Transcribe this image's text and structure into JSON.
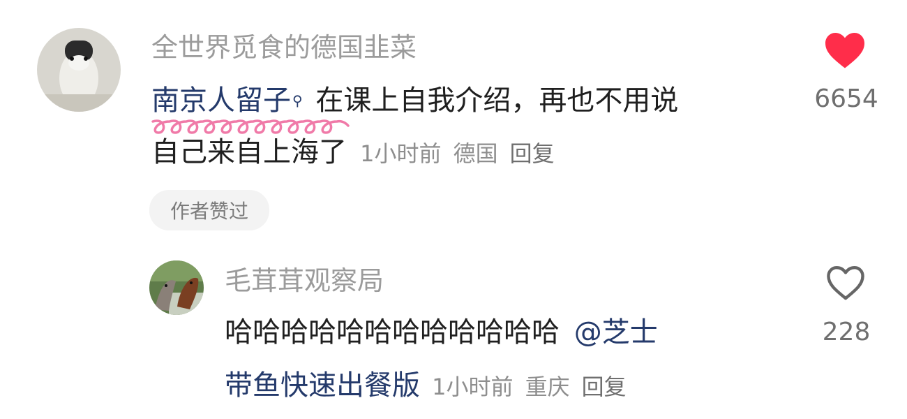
{
  "comment": {
    "username": "全世界觅食的德国韭菜",
    "tag": "南京人留子",
    "text_line1": "在课上自我介绍，再也不用说",
    "text_line2": "自己来自上海了",
    "time": "1小时前",
    "location": "德国",
    "reply_label": "回复",
    "like_count": "6654",
    "liked": true,
    "like_color": "#ff2d4a",
    "author_liked_chip": "作者赞过"
  },
  "reply": {
    "username": "毛茸茸观察局",
    "text": "哈哈哈哈哈哈哈哈哈哈哈哈",
    "mention_line1": "@芝士",
    "mention_line2": "带鱼快速出餐版",
    "time": "1小时前",
    "location": "重庆",
    "reply_label": "回复",
    "like_count": "228",
    "liked": false
  }
}
